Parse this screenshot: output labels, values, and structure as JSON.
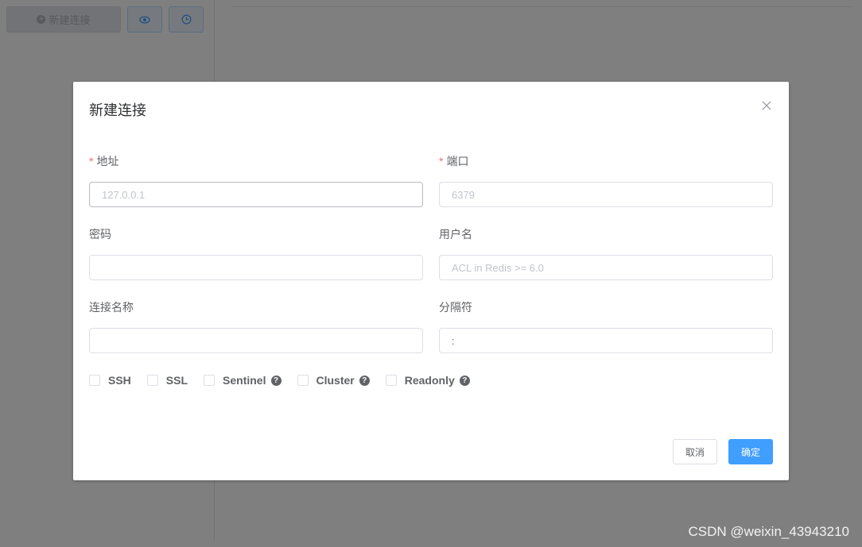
{
  "colors": {
    "accent": "#409eff",
    "required": "#f56c6c",
    "overlay": "rgba(0,0,0,0.5)"
  },
  "toolbar": {
    "new_connection_label": "新建连接",
    "icon_1": "eye-icon",
    "icon_2": "clock-icon"
  },
  "dialog": {
    "title": "新建连接",
    "close_icon": "close-icon",
    "fields": {
      "host": {
        "label": "地址",
        "placeholder": "127.0.0.1",
        "value": "",
        "required": true
      },
      "port": {
        "label": "端口",
        "placeholder": "6379",
        "value": "",
        "required": true
      },
      "password": {
        "label": "密码",
        "placeholder": "",
        "value": ""
      },
      "username": {
        "label": "用户名",
        "placeholder": "ACL in Redis >= 6.0",
        "value": ""
      },
      "name": {
        "label": "连接名称",
        "placeholder": "",
        "value": ""
      },
      "separator": {
        "label": "分隔符",
        "placeholder": "",
        "value": ":"
      }
    },
    "options": [
      {
        "label": "SSH",
        "checked": false,
        "help": false
      },
      {
        "label": "SSL",
        "checked": false,
        "help": false
      },
      {
        "label": "Sentinel",
        "checked": false,
        "help": true
      },
      {
        "label": "Cluster",
        "checked": false,
        "help": true
      },
      {
        "label": "Readonly",
        "checked": false,
        "help": true
      }
    ],
    "help_glyph": "?",
    "required_mark": "*",
    "cancel_label": "取消",
    "confirm_label": "确定"
  },
  "watermark": "CSDN @weixin_43943210"
}
